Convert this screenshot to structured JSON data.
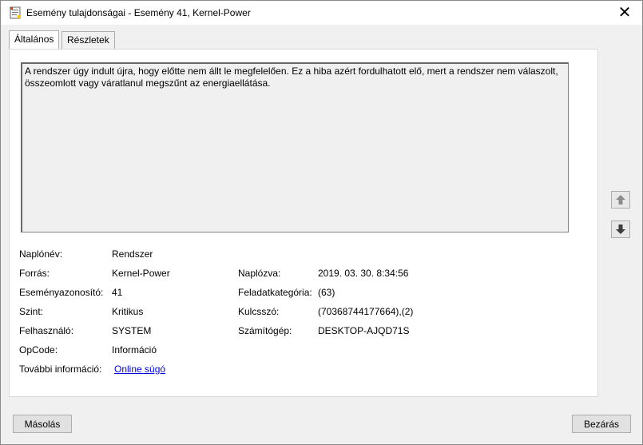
{
  "window": {
    "title": "Esemény tulajdonságai - Esemény 41, Kernel-Power",
    "close_symbol": "✕"
  },
  "tabs": [
    {
      "label": "Általános",
      "active": true
    },
    {
      "label": "Részletek",
      "active": false
    }
  ],
  "description": "A rendszer úgy indult újra, hogy előtte nem állt le megfelelően. Ez a hiba azért fordulhatott elő, mert a rendszer nem válaszolt, összeomlott vagy váratlanul megszűnt az energiaellátása.",
  "fields": {
    "log_name": {
      "label": "Naplónév:",
      "value": "Rendszer"
    },
    "source": {
      "label": "Forrás:",
      "value": "Kernel-Power"
    },
    "event_id": {
      "label": "Eseményazonosító:",
      "value": "41"
    },
    "level": {
      "label": "Szint:",
      "value": "Kritikus"
    },
    "user": {
      "label": "Felhasználó:",
      "value": "SYSTEM"
    },
    "opcode": {
      "label": "OpCode:",
      "value": "Információ"
    },
    "more_info": {
      "label": "További információ:",
      "value": "Online súgó"
    },
    "logged": {
      "label": "Naplózva:",
      "value": "2019. 03. 30. 8:34:56"
    },
    "task_category": {
      "label": "Feladatkategória:",
      "value": "(63)"
    },
    "keywords": {
      "label": "Kulcsszó:",
      "value": "(70368744177664),(2)"
    },
    "computer": {
      "label": "Számítógép:",
      "value": "DESKTOP-AJQD71S"
    }
  },
  "buttons": {
    "copy": "Másolás",
    "close": "Bezárás"
  },
  "icons": {
    "app": "event-properties-icon",
    "up": "arrow-up-icon",
    "down": "arrow-down-icon"
  }
}
